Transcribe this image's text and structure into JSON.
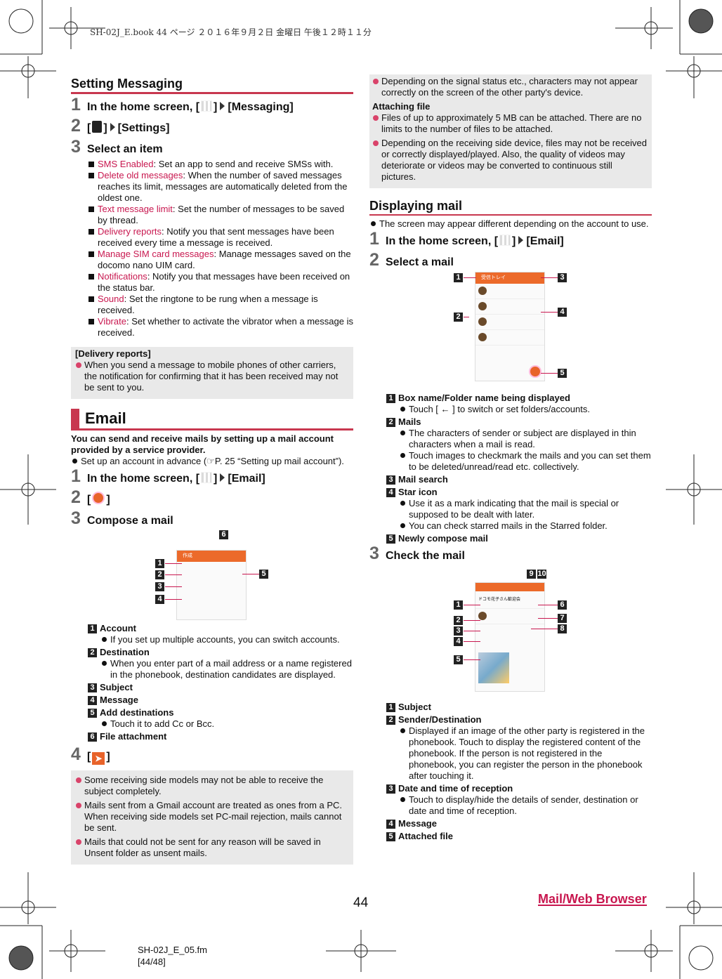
{
  "print_header": "SH-02J_E.book  44 ページ  ２０１６年９月２日  金曜日  午後１２時１１分",
  "setting_messaging": {
    "title": "Setting Messaging",
    "step1_pre": "In the home screen, [",
    "step1_post": "]",
    "step1_target": "[Messaging]",
    "step2_pre": "[",
    "step2_post": "]",
    "step2_target": "[Settings]",
    "step3": "Select an item",
    "items": [
      {
        "term": "SMS Enabled",
        "desc": ": Set an app to send and receive SMSs with."
      },
      {
        "term": "Delete old messages",
        "desc": ": When the number of saved messages reaches its limit, messages are automatically deleted from the oldest one."
      },
      {
        "term": "Text message limit",
        "desc": ": Set the number of messages to be saved by thread."
      },
      {
        "term": "Delivery reports",
        "desc": ": Notify you that sent messages have been received every time a message is received."
      },
      {
        "term": "Manage SIM card messages",
        "desc": ": Manage messages saved on the docomo nano UIM card."
      },
      {
        "term": "Notifications",
        "desc": ": Notify you that messages have been received on the status bar."
      },
      {
        "term": "Sound",
        "desc": ": Set the ringtone to be rung when a message is received."
      },
      {
        "term": "Vibrate",
        "desc": ": Set whether to activate the vibrator when a message is received."
      }
    ],
    "box_title": "[Delivery reports]",
    "box_notes": [
      "When you send a message to mobile phones of other carriers, the notification for confirming that it has been received may not be sent to you."
    ]
  },
  "email": {
    "title": "Email",
    "lead": "You can send and receive mails by setting up a mail account provided by a service provider.",
    "bullets": [
      "Set up an account in advance (☞P. 25 “Setting up mail account”)."
    ],
    "step1_pre": "In the home screen, [",
    "step1_post": "]",
    "step1_target": "[Email]",
    "step2_pre": "[",
    "step2_post": "]",
    "step3": "Compose a mail",
    "screen_title": "作成",
    "legend": [
      {
        "num": "1",
        "title": "Account",
        "bullets": [
          "If you set up multiple accounts, you can switch accounts."
        ]
      },
      {
        "num": "2",
        "title": "Destination",
        "bullets": [
          "When you enter part of a mail address or a name registered in the phonebook, destination candidates are displayed."
        ]
      },
      {
        "num": "3",
        "title": "Subject",
        "bullets": []
      },
      {
        "num": "4",
        "title": "Message",
        "bullets": []
      },
      {
        "num": "5",
        "title": "Add destinations",
        "bullets": [
          "Touch it to add Cc or Bcc."
        ]
      },
      {
        "num": "6",
        "title": "File attachment",
        "bullets": []
      }
    ],
    "step4_pre": "[",
    "step4_post": "]",
    "notes": [
      "Some receiving side models may not be able to receive the subject completely.",
      "Mails sent from a Gmail account are treated as ones from a PC. When receiving side models set PC-mail rejection, mails cannot be sent.",
      "Mails that could not be sent for any reason will be saved in Unsent folder as unsent mails."
    ]
  },
  "right_box": {
    "notes1": [
      "Depending on the signal status etc., characters may not appear correctly on the screen of the other party's device."
    ],
    "title": "Attaching file",
    "notes2": [
      "Files of up to approximately 5 MB can be attached. There are no limits to the number of files to be attached.",
      "Depending on the receiving side device, files may not be received or correctly displayed/played. Also, the quality of videos may deteriorate or videos may be converted to continuous still pictures."
    ]
  },
  "displaying_mail": {
    "title": "Displaying mail",
    "bullets": [
      "The screen may appear different depending on the account to use."
    ],
    "step1_pre": "In the home screen, [",
    "step1_post": "]",
    "step1_target": "[Email]",
    "step2": "Select a mail",
    "screen_title": "受信トレイ",
    "legend": [
      {
        "num": "1",
        "title": "Box name/Folder name being displayed",
        "bullets": [
          "Touch [ ← ] to switch or set folders/accounts."
        ]
      },
      {
        "num": "2",
        "title": "Mails",
        "bullets": [
          "The characters of sender or subject are displayed in thin characters when a mail is read.",
          "Touch images to checkmark the mails and you can set them to be deleted/unread/read etc. collectively."
        ]
      },
      {
        "num": "3",
        "title": "Mail search",
        "bullets": []
      },
      {
        "num": "4",
        "title": "Star icon",
        "bullets": [
          "Use it as a mark indicating that the mail is special or supposed to be dealt with later.",
          "You can check starred mails in the Starred folder."
        ]
      },
      {
        "num": "5",
        "title": "Newly compose mail",
        "bullets": []
      }
    ],
    "step3": "Check the mail",
    "screen2_title": "ドコモ花子さん歓迎会",
    "legend2": [
      {
        "num": "1",
        "title": "Subject",
        "bullets": []
      },
      {
        "num": "2",
        "title": "Sender/Destination",
        "bullets": [
          "Displayed if an image of the other party is registered in the phonebook. Touch to display the registered content of the phonebook. If the person is not registered in the phonebook, you can register the person in the phonebook after touching it."
        ]
      },
      {
        "num": "3",
        "title": "Date and time of reception",
        "bullets": [
          "Touch to display/hide the details of sender, destination or date and time of reception."
        ]
      },
      {
        "num": "4",
        "title": "Message",
        "bullets": []
      },
      {
        "num": "5",
        "title": "Attached file",
        "bullets": []
      }
    ]
  },
  "callouts": {
    "c1": "1",
    "c2": "2",
    "c3": "3",
    "c4": "4",
    "c5": "5",
    "c6": "6",
    "c7": "7",
    "c8": "8",
    "c9": "9",
    "c10": "10"
  },
  "footer": {
    "page": "44",
    "chapter": "Mail/Web Browser",
    "file": "SH-02J_E_05.fm",
    "pages": "[44/48]"
  },
  "colors": {
    "accent": "#c8374f",
    "orange": "#ec6a2a",
    "note_bg": "#e9e9e9"
  }
}
